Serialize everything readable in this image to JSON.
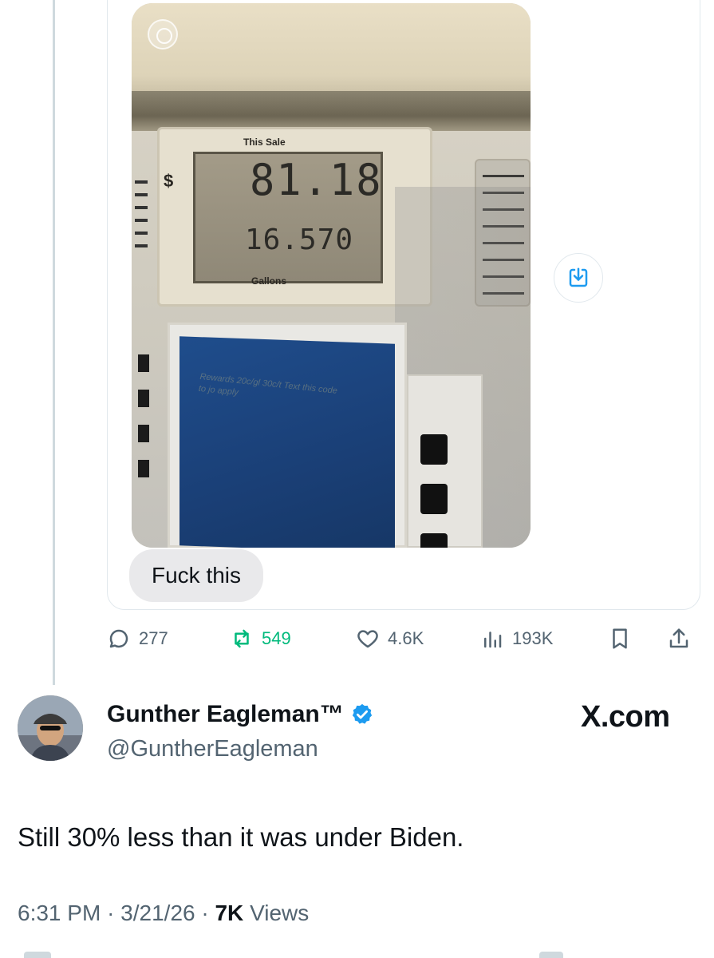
{
  "photo": {
    "display": {
      "this_sale_label": "This Sale",
      "dollar_sign": "$",
      "sale_amount": "81.18",
      "gallons_amount": "16.570",
      "gallons_label": "Gallons"
    },
    "screen_text": "Rewards 20c/gl 30c/t Text this code to jo apply"
  },
  "quoted_message": {
    "bubble_text": "Fuck this"
  },
  "actions": {
    "replies": "277",
    "reposts": "549",
    "likes": "4.6K",
    "views": "193K"
  },
  "author": {
    "name": "Gunther Eagleman™",
    "handle": "@GuntherEagleman",
    "verified": true
  },
  "brand_watermark": "X.com",
  "tweet": {
    "text": "Still 30% less than it was under Biden.",
    "time": "6:31 PM",
    "date": "3/21/26",
    "views_count": "7K",
    "views_label": "Views"
  },
  "colors": {
    "text_primary": "#0f1419",
    "text_secondary": "#536471",
    "repost_green": "#00ba7c",
    "accent_blue": "#1d9bf0"
  }
}
